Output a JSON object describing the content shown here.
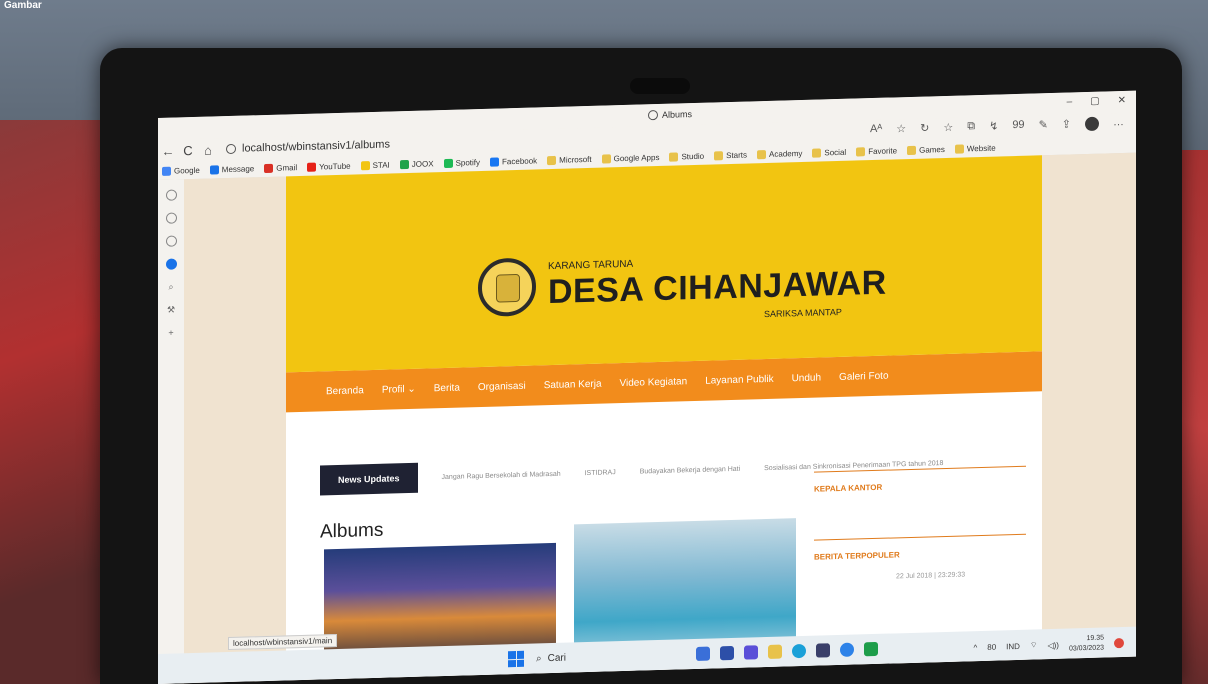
{
  "caption": "Gambar",
  "window": {
    "title": "Albums",
    "controls": [
      "–",
      "▢",
      "✕"
    ]
  },
  "address": {
    "url": "localhost/wbinstansiv1/albums",
    "nav": {
      "back": "←",
      "refresh": "C",
      "home": "⌂"
    },
    "toolbar": [
      "Aᴬ",
      "☆",
      "↻",
      "☆",
      "⧉",
      "↯",
      "99",
      "✎",
      "⇪",
      "…"
    ]
  },
  "favorites": [
    {
      "label": "Google",
      "color": "#4285f4"
    },
    {
      "label": "Message",
      "color": "#1a73e8"
    },
    {
      "label": "Gmail",
      "color": "#d93025"
    },
    {
      "label": "YouTube",
      "color": "#e62117"
    },
    {
      "label": "STAI",
      "color": "#f2c511"
    },
    {
      "label": "JOOX",
      "color": "#1fa34a"
    },
    {
      "label": "Spotify",
      "color": "#1db954"
    },
    {
      "label": "Facebook",
      "color": "#1877f2"
    },
    {
      "label": "Microsoft",
      "color": "#e8c24a"
    },
    {
      "label": "Google Apps",
      "color": "#e8c24a"
    },
    {
      "label": "Studio",
      "color": "#e8c24a"
    },
    {
      "label": "Starts",
      "color": "#e8c24a"
    },
    {
      "label": "Academy",
      "color": "#e8c24a"
    },
    {
      "label": "Social",
      "color": "#e8c24a"
    },
    {
      "label": "Favorite",
      "color": "#e8c24a"
    },
    {
      "label": "Games",
      "color": "#e8c24a"
    },
    {
      "label": "Website",
      "color": "#e8c24a"
    }
  ],
  "site": {
    "org_small": "KARANG TARUNA",
    "org_name": "DESA CIHANJAWAR",
    "org_tagline": "SARIKSA MANTAP",
    "nav": [
      "Beranda",
      "Profil ⌄",
      "Berita",
      "Organisasi",
      "Satuan Kerja",
      "Video Kegiatan",
      "Layanan Publik",
      "Unduh",
      "Galeri Foto"
    ],
    "news_label": "News Updates",
    "news_items": [
      "Jangan Ragu Bersekolah di Madrasah",
      "ISTIDRAJ",
      "Budayakan Bekerja dengan Hati",
      "Sosialisasi dan Sinkronisasi Penerimaan TPG tahun 2018"
    ],
    "albums_title": "Albums",
    "widget_kepala": "KEPALA KANTOR",
    "widget_berita": "BERITA TERPOPULER",
    "popular_date": "22 Jul 2018 | 23:29:33"
  },
  "status_url": "localhost/wbinstansiv1/main",
  "taskbar": {
    "search": "Cari",
    "tray": [
      "^",
      "80",
      "IND",
      "⌔",
      "◁))"
    ],
    "time": "19.35",
    "date": "03/03/2023"
  },
  "colors": {
    "banner": "#f2c511",
    "navbar": "#f28c1c",
    "accent": "#e07b1c"
  }
}
